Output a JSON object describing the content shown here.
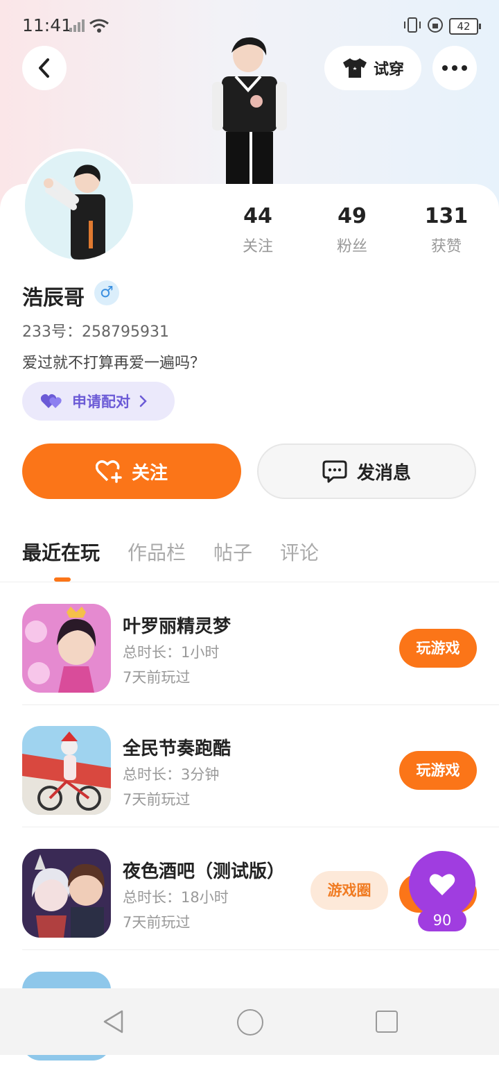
{
  "status_bar": {
    "time": "11:41",
    "battery": "42"
  },
  "header": {
    "tryon_label": "试穿"
  },
  "profile": {
    "name": "浩辰哥",
    "gender_symbol": "♂",
    "uid": "233号：258795931",
    "bio": "爱过就不打算再爱一遍吗？",
    "pair_label": "申请配对",
    "stats": [
      {
        "value": "44",
        "label": "关注"
      },
      {
        "value": "49",
        "label": "粉丝"
      },
      {
        "value": "131",
        "label": "获赞"
      }
    ]
  },
  "actions": {
    "follow_label": "关注",
    "message_label": "发消息"
  },
  "tabs": [
    "最近在玩",
    "作品栏",
    "帖子",
    "评论"
  ],
  "games": [
    {
      "name": "叶罗丽精灵梦",
      "duration": "总时长：1小时",
      "last_played": "7天前玩过",
      "play_label": "玩游戏"
    },
    {
      "name": "全民节奏跑酷",
      "duration": "总时长：3分钟",
      "last_played": "7天前玩过",
      "play_label": "玩游戏"
    },
    {
      "name": "夜色酒吧（测试版）",
      "duration": "总时长：18小时",
      "last_played": "7天前玩过",
      "play_label": "玩游戏",
      "circle_label": "游戏圈"
    }
  ],
  "like_fab": {
    "count": "90"
  },
  "colors": {
    "accent": "#fb7518",
    "purple": "#a03de0",
    "pair_text": "#6b5ad6"
  }
}
